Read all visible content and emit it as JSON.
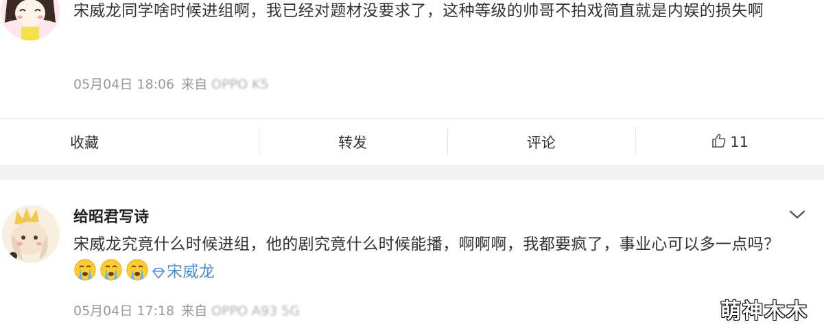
{
  "comment1": {
    "text": "宋威龙同学啥时候进组啊，我已经对题材没要求了，这种等级的帅哥不拍戏简直就是内娱的损失啊",
    "date": "05月04日 18:06",
    "source_prefix": "来自",
    "source_device": "OPPO K5"
  },
  "actions": {
    "favorite": "收藏",
    "repost": "转发",
    "comment": "评论",
    "like_count": "11"
  },
  "comment2": {
    "username": "给昭君写诗",
    "text": "宋威龙究竟什么时候进组，他的剧究竟什么时候能播，啊啊啊，我都要疯了，事业心可以多一点吗？",
    "mention": "宋威龙",
    "emojis": [
      "crying-face",
      "crying-face",
      "crying-face"
    ],
    "date": "05月04日 17:18",
    "source_prefix": "来自",
    "source_device": "OPPO A93 5G"
  },
  "watermark": "萌神木木",
  "colors": {
    "mention": "#4a8bd8",
    "meta": "#999999",
    "band": "#f2f2f2"
  }
}
